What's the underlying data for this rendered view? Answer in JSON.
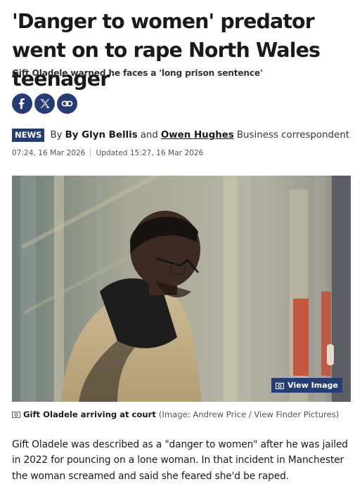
{
  "article": {
    "headline": "'Danger to women' predator went on to rape North Wales teenager",
    "standfirst": "Gift Oladele warned he faces a 'long prison sentence'",
    "share": [
      {
        "name": "facebook",
        "icon": "facebook-icon"
      },
      {
        "name": "x",
        "icon": "x-icon"
      },
      {
        "name": "copy-link",
        "icon": "link-icon"
      }
    ],
    "byline": {
      "badge": "NEWS",
      "by": "By",
      "author1": "By Glyn Bellis",
      "and": "and",
      "author2": "Owen Hughes",
      "role": "Business correspondent"
    },
    "published": "07:24, 16 Mar 2026",
    "updated": "Updated 15:27, 16 Mar 2026",
    "image": {
      "view_label": "View Image",
      "caption": "Gift Oladele arriving at court",
      "credit": "(Image: Andrew Price / View Finder Pictures)"
    },
    "body": "Gift Oladele was described as a \"danger to women\" after he was jailed in 2022 for pouncing on a lone woman. In that incident in Manchester the woman screamed and said she feared she'd be raped."
  },
  "colors": {
    "brand_navy": "#253d74",
    "share_blue": "#253d74",
    "text": "#1a1a1a"
  }
}
